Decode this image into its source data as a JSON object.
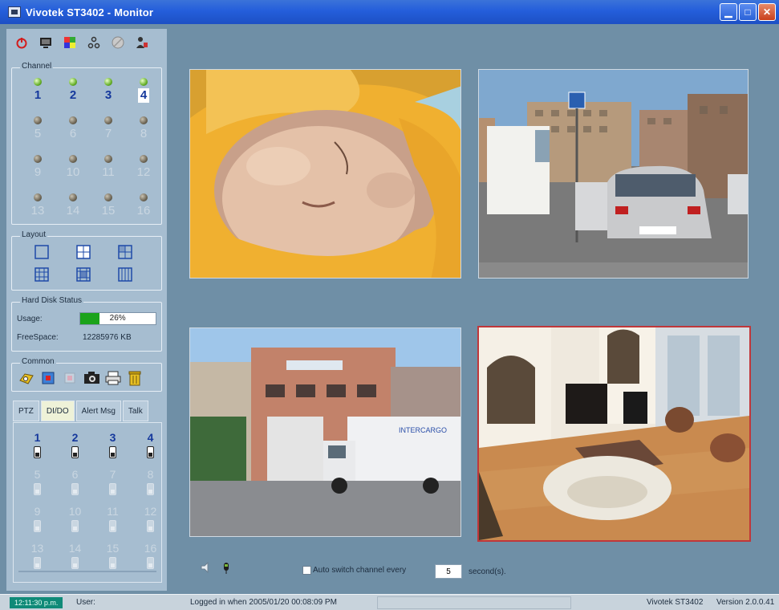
{
  "window": {
    "title": "Vivotek ST3402 - Monitor",
    "buttons": [
      "minimize",
      "maximize",
      "close"
    ]
  },
  "toolbar": {
    "icons": [
      "power-icon",
      "monitor-icon",
      "color-icon",
      "network-icon",
      "disk-icon",
      "user-icon"
    ]
  },
  "channel": {
    "label": "Channel",
    "items": [
      {
        "num": "1",
        "state": "active"
      },
      {
        "num": "2",
        "state": "active"
      },
      {
        "num": "3",
        "state": "active"
      },
      {
        "num": "4",
        "state": "selected"
      },
      {
        "num": "5",
        "state": "inactive"
      },
      {
        "num": "6",
        "state": "inactive"
      },
      {
        "num": "7",
        "state": "inactive"
      },
      {
        "num": "8",
        "state": "inactive"
      },
      {
        "num": "9",
        "state": "inactive"
      },
      {
        "num": "10",
        "state": "inactive"
      },
      {
        "num": "11",
        "state": "inactive"
      },
      {
        "num": "12",
        "state": "inactive"
      },
      {
        "num": "13",
        "state": "inactive"
      },
      {
        "num": "14",
        "state": "inactive"
      },
      {
        "num": "15",
        "state": "inactive"
      },
      {
        "num": "16",
        "state": "inactive"
      }
    ]
  },
  "layout": {
    "label": "Layout",
    "options": [
      "1x1",
      "2x2",
      "1+3",
      "3x3",
      "1+8",
      "4x4"
    ]
  },
  "hdd": {
    "label": "Hard Disk Status",
    "usage_label": "Usage:",
    "usage_value": "26%",
    "usage_fraction": 0.26,
    "free_label": "FreeSpace:",
    "free_value": "12285976 KB"
  },
  "common": {
    "label": "Common",
    "icons": [
      "open-icon",
      "record-icon",
      "stop-icon",
      "snapshot-icon",
      "print-icon",
      "delete-icon"
    ]
  },
  "tabs": [
    "PTZ",
    "DI/DO",
    "Alert Msg",
    "Talk"
  ],
  "dio": {
    "items": [
      {
        "num": "1",
        "state": "active"
      },
      {
        "num": "2",
        "state": "active"
      },
      {
        "num": "3",
        "state": "active"
      },
      {
        "num": "4",
        "state": "active"
      },
      {
        "num": "5",
        "state": "inactive"
      },
      {
        "num": "6",
        "state": "inactive"
      },
      {
        "num": "7",
        "state": "inactive"
      },
      {
        "num": "8",
        "state": "inactive"
      },
      {
        "num": "9",
        "state": "inactive"
      },
      {
        "num": "10",
        "state": "inactive"
      },
      {
        "num": "11",
        "state": "inactive"
      },
      {
        "num": "12",
        "state": "inactive"
      },
      {
        "num": "13",
        "state": "inactive"
      },
      {
        "num": "14",
        "state": "inactive"
      },
      {
        "num": "15",
        "state": "inactive"
      },
      {
        "num": "16",
        "state": "inactive"
      }
    ]
  },
  "videos": [
    {
      "scene": "sleeping baby",
      "selected": false
    },
    {
      "scene": "street with cars",
      "selected": false
    },
    {
      "scene": "building and truck",
      "selected": false
    },
    {
      "scene": "living room",
      "selected": true
    }
  ],
  "bottom": {
    "autoswitch_label": "Auto switch channel every",
    "seconds_value": "5",
    "seconds_label": "second(s)."
  },
  "status": {
    "clock": "12:11:30 p.m.",
    "user": "User:",
    "login": "Logged in when  2005/01/20 00:08:09 PM",
    "model": "Vivotek ST3402",
    "version": "Version 2.0.0.41"
  },
  "colors": {
    "background": "#6f8fa6",
    "panel": "#a6bdd0",
    "active_channel": "#15389c",
    "selected_border": "#c0373a",
    "usage_fill": "#1ba31b"
  }
}
